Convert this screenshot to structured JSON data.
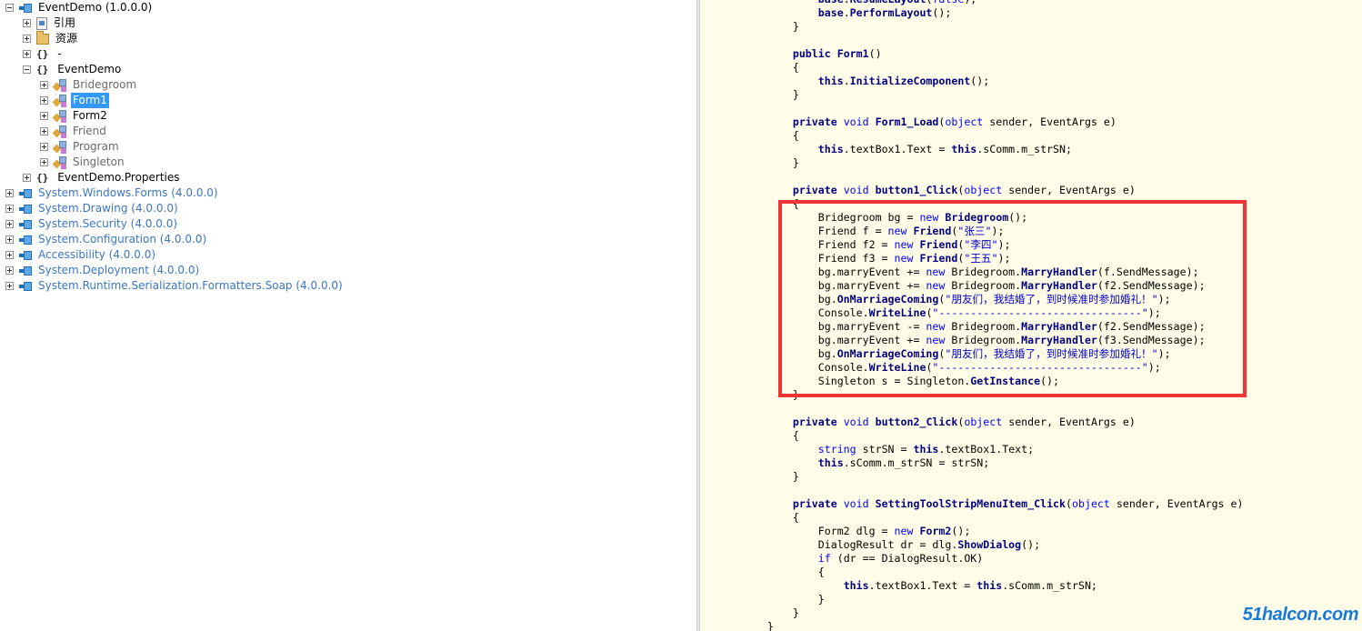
{
  "tree": {
    "root": {
      "name": "EventDemo",
      "version": "(1.0.0.0)"
    },
    "refs_label": "引用",
    "resources_label": "资源",
    "dash_namespace": "-",
    "ns_eventdemo": "EventDemo",
    "classes": [
      {
        "name": "Bridegroom",
        "style": "gray"
      },
      {
        "name": "Form1",
        "style": "selected"
      },
      {
        "name": "Form2",
        "style": "normal"
      },
      {
        "name": "Friend",
        "style": "gray"
      },
      {
        "name": "Program",
        "style": "gray"
      },
      {
        "name": "Singleton",
        "style": "gray"
      }
    ],
    "ns_properties": "EventDemo.Properties",
    "assemblies": [
      {
        "name": "System.Windows.Forms",
        "version": "(4.0.0.0)"
      },
      {
        "name": "System.Drawing",
        "version": "(4.0.0.0)"
      },
      {
        "name": "System.Security",
        "version": "(4.0.0.0)"
      },
      {
        "name": "System.Configuration",
        "version": "(4.0.0.0)"
      },
      {
        "name": "Accessibility",
        "version": "(4.0.0.0)"
      },
      {
        "name": "System.Deployment",
        "version": "(4.0.0.0)"
      },
      {
        "name": "System.Runtime.Serialization.Formatters.Soap",
        "version": "(4.0.0.0)"
      }
    ]
  },
  "code_lines": [
    [
      [
        "p",
        "            "
      ],
      [
        "kb",
        "base"
      ],
      [
        "p",
        "."
      ],
      [
        "mt",
        "ResumeLayout"
      ],
      [
        "p",
        "("
      ],
      [
        "kw",
        "false"
      ],
      [
        "p",
        ");"
      ]
    ],
    [
      [
        "p",
        "            "
      ],
      [
        "kb",
        "base"
      ],
      [
        "p",
        "."
      ],
      [
        "mt",
        "PerformLayout"
      ],
      [
        "p",
        "();"
      ]
    ],
    [
      [
        "p",
        "        }"
      ]
    ],
    [
      [
        "p",
        ""
      ]
    ],
    [
      [
        "p",
        "        "
      ],
      [
        "kb",
        "public"
      ],
      [
        "p",
        " "
      ],
      [
        "mt",
        "Form1"
      ],
      [
        "p",
        "()"
      ]
    ],
    [
      [
        "p",
        "        {"
      ]
    ],
    [
      [
        "p",
        "            "
      ],
      [
        "kb",
        "this"
      ],
      [
        "p",
        "."
      ],
      [
        "mt",
        "InitializeComponent"
      ],
      [
        "p",
        "();"
      ]
    ],
    [
      [
        "p",
        "        }"
      ]
    ],
    [
      [
        "p",
        ""
      ]
    ],
    [
      [
        "p",
        "        "
      ],
      [
        "kb",
        "private"
      ],
      [
        "p",
        " "
      ],
      [
        "kw",
        "void"
      ],
      [
        "p",
        " "
      ],
      [
        "mt",
        "Form1_Load"
      ],
      [
        "p",
        "("
      ],
      [
        "kw",
        "object"
      ],
      [
        "p",
        " sender, EventArgs e)"
      ]
    ],
    [
      [
        "p",
        "        {"
      ]
    ],
    [
      [
        "p",
        "            "
      ],
      [
        "kb",
        "this"
      ],
      [
        "p",
        ".textBox1.Text = "
      ],
      [
        "kb",
        "this"
      ],
      [
        "p",
        ".sComm.m_strSN;"
      ]
    ],
    [
      [
        "p",
        "        }"
      ]
    ],
    [
      [
        "p",
        ""
      ]
    ],
    [
      [
        "p",
        "        "
      ],
      [
        "kb",
        "private"
      ],
      [
        "p",
        " "
      ],
      [
        "kw",
        "void"
      ],
      [
        "p",
        " "
      ],
      [
        "mt",
        "button1_Click"
      ],
      [
        "p",
        "("
      ],
      [
        "kw",
        "object"
      ],
      [
        "p",
        " sender, EventArgs e)"
      ]
    ],
    [
      [
        "p",
        "        {"
      ]
    ],
    [
      [
        "p",
        "            Bridegroom bg = "
      ],
      [
        "kw",
        "new"
      ],
      [
        "p",
        " "
      ],
      [
        "mt",
        "Bridegroom"
      ],
      [
        "p",
        "();"
      ]
    ],
    [
      [
        "p",
        "            Friend f = "
      ],
      [
        "kw",
        "new"
      ],
      [
        "p",
        " "
      ],
      [
        "mt",
        "Friend"
      ],
      [
        "p",
        "("
      ],
      [
        "str",
        "\"张三\""
      ],
      [
        "p",
        ");"
      ]
    ],
    [
      [
        "p",
        "            Friend f2 = "
      ],
      [
        "kw",
        "new"
      ],
      [
        "p",
        " "
      ],
      [
        "mt",
        "Friend"
      ],
      [
        "p",
        "("
      ],
      [
        "str",
        "\"李四\""
      ],
      [
        "p",
        ");"
      ]
    ],
    [
      [
        "p",
        "            Friend f3 = "
      ],
      [
        "kw",
        "new"
      ],
      [
        "p",
        " "
      ],
      [
        "mt",
        "Friend"
      ],
      [
        "p",
        "("
      ],
      [
        "str",
        "\"王五\""
      ],
      [
        "p",
        ");"
      ]
    ],
    [
      [
        "p",
        "            bg.marryEvent += "
      ],
      [
        "kw",
        "new"
      ],
      [
        "p",
        " Bridegroom."
      ],
      [
        "mt",
        "MarryHandler"
      ],
      [
        "p",
        "(f.SendMessage);"
      ]
    ],
    [
      [
        "p",
        "            bg.marryEvent += "
      ],
      [
        "kw",
        "new"
      ],
      [
        "p",
        " Bridegroom."
      ],
      [
        "mt",
        "MarryHandler"
      ],
      [
        "p",
        "(f2.SendMessage);"
      ]
    ],
    [
      [
        "p",
        "            bg."
      ],
      [
        "mt",
        "OnMarriageComing"
      ],
      [
        "p",
        "("
      ],
      [
        "str",
        "\"朋友们，我结婚了，到时候准时参加婚礼！\""
      ],
      [
        "p",
        ");"
      ]
    ],
    [
      [
        "p",
        "            Console."
      ],
      [
        "mt",
        "WriteLine"
      ],
      [
        "p",
        "("
      ],
      [
        "str",
        "\"--------------------------------\""
      ],
      [
        "p",
        ");"
      ]
    ],
    [
      [
        "p",
        "            bg.marryEvent -= "
      ],
      [
        "kw",
        "new"
      ],
      [
        "p",
        " Bridegroom."
      ],
      [
        "mt",
        "MarryHandler"
      ],
      [
        "p",
        "(f2.SendMessage);"
      ]
    ],
    [
      [
        "p",
        "            bg.marryEvent += "
      ],
      [
        "kw",
        "new"
      ],
      [
        "p",
        " Bridegroom."
      ],
      [
        "mt",
        "MarryHandler"
      ],
      [
        "p",
        "(f3.SendMessage);"
      ]
    ],
    [
      [
        "p",
        "            bg."
      ],
      [
        "mt",
        "OnMarriageComing"
      ],
      [
        "p",
        "("
      ],
      [
        "str",
        "\"朋友们，我结婚了，到时候准时参加婚礼！\""
      ],
      [
        "p",
        ");"
      ]
    ],
    [
      [
        "p",
        "            Console."
      ],
      [
        "mt",
        "WriteLine"
      ],
      [
        "p",
        "("
      ],
      [
        "str",
        "\"--------------------------------\""
      ],
      [
        "p",
        ");"
      ]
    ],
    [
      [
        "p",
        "            Singleton s = Singleton."
      ],
      [
        "mt",
        "GetInstance"
      ],
      [
        "p",
        "();"
      ]
    ],
    [
      [
        "p",
        "        }"
      ]
    ],
    [
      [
        "p",
        ""
      ]
    ],
    [
      [
        "p",
        "        "
      ],
      [
        "kb",
        "private"
      ],
      [
        "p",
        " "
      ],
      [
        "kw",
        "void"
      ],
      [
        "p",
        " "
      ],
      [
        "mt",
        "button2_Click"
      ],
      [
        "p",
        "("
      ],
      [
        "kw",
        "object"
      ],
      [
        "p",
        " sender, EventArgs e)"
      ]
    ],
    [
      [
        "p",
        "        {"
      ]
    ],
    [
      [
        "p",
        "            "
      ],
      [
        "kw",
        "string"
      ],
      [
        "p",
        " strSN = "
      ],
      [
        "kb",
        "this"
      ],
      [
        "p",
        ".textBox1.Text;"
      ]
    ],
    [
      [
        "p",
        "            "
      ],
      [
        "kb",
        "this"
      ],
      [
        "p",
        ".sComm.m_strSN = strSN;"
      ]
    ],
    [
      [
        "p",
        "        }"
      ]
    ],
    [
      [
        "p",
        ""
      ]
    ],
    [
      [
        "p",
        "        "
      ],
      [
        "kb",
        "private"
      ],
      [
        "p",
        " "
      ],
      [
        "kw",
        "void"
      ],
      [
        "p",
        " "
      ],
      [
        "mt",
        "SettingToolStripMenuItem_Click"
      ],
      [
        "p",
        "("
      ],
      [
        "kw",
        "object"
      ],
      [
        "p",
        " sender, EventArgs e)"
      ]
    ],
    [
      [
        "p",
        "        {"
      ]
    ],
    [
      [
        "p",
        "            Form2 dlg = "
      ],
      [
        "kw",
        "new"
      ],
      [
        "p",
        " "
      ],
      [
        "mt",
        "Form2"
      ],
      [
        "p",
        "();"
      ]
    ],
    [
      [
        "p",
        "            DialogResult dr = dlg."
      ],
      [
        "mt",
        "ShowDialog"
      ],
      [
        "p",
        "();"
      ]
    ],
    [
      [
        "p",
        "            "
      ],
      [
        "kw",
        "if"
      ],
      [
        "p",
        " (dr == DialogResult.OK)"
      ]
    ],
    [
      [
        "p",
        "            {"
      ]
    ],
    [
      [
        "p",
        "                "
      ],
      [
        "kb",
        "this"
      ],
      [
        "p",
        ".textBox1.Text = "
      ],
      [
        "kb",
        "this"
      ],
      [
        "p",
        ".sComm.m_strSN;"
      ]
    ],
    [
      [
        "p",
        "            }"
      ]
    ],
    [
      [
        "p",
        "        }"
      ]
    ],
    [
      [
        "p",
        "    }"
      ]
    ]
  ],
  "watermark": "51halcon.com"
}
